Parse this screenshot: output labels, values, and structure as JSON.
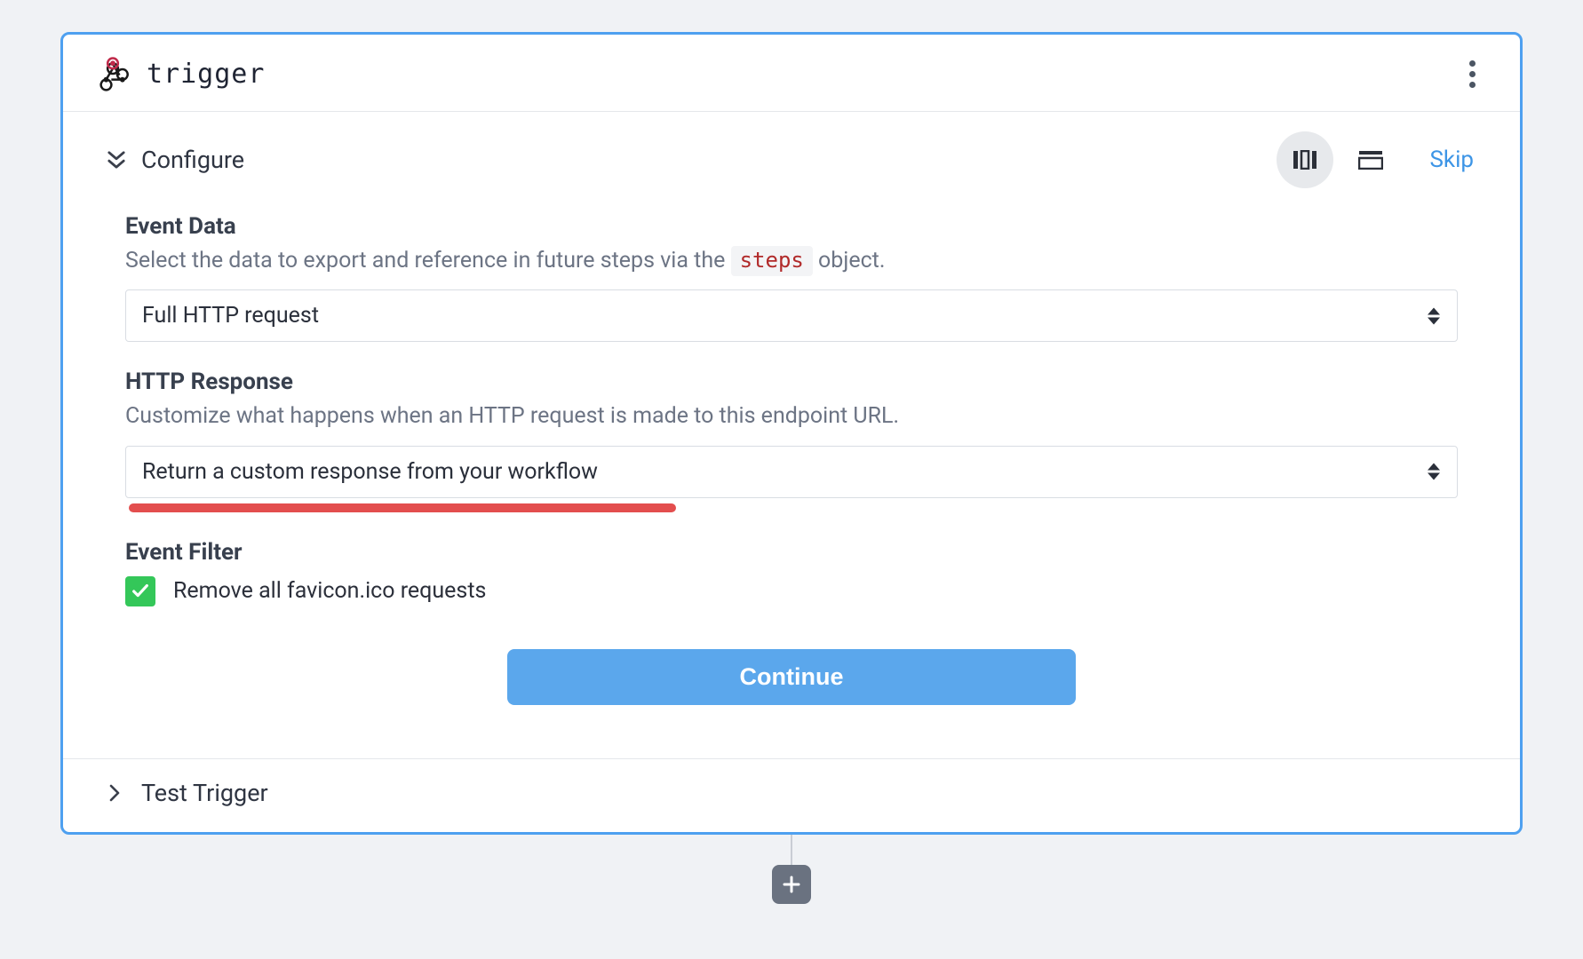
{
  "header": {
    "title": "trigger"
  },
  "configure": {
    "title": "Configure",
    "skip_label": "Skip"
  },
  "event_data": {
    "label": "Event Data",
    "description_pre": "Select the data to export and reference in future steps via the ",
    "description_code": "steps",
    "description_post": " object.",
    "value": "Full HTTP request"
  },
  "http_response": {
    "label": "HTTP Response",
    "description": "Customize what happens when an HTTP request is made to this endpoint URL.",
    "value": "Return a custom response from your workflow"
  },
  "event_filter": {
    "label": "Event Filter",
    "checkbox_label": "Remove all favicon.ico requests",
    "checked": true
  },
  "continue_label": "Continue",
  "footer": {
    "title": "Test Trigger"
  }
}
